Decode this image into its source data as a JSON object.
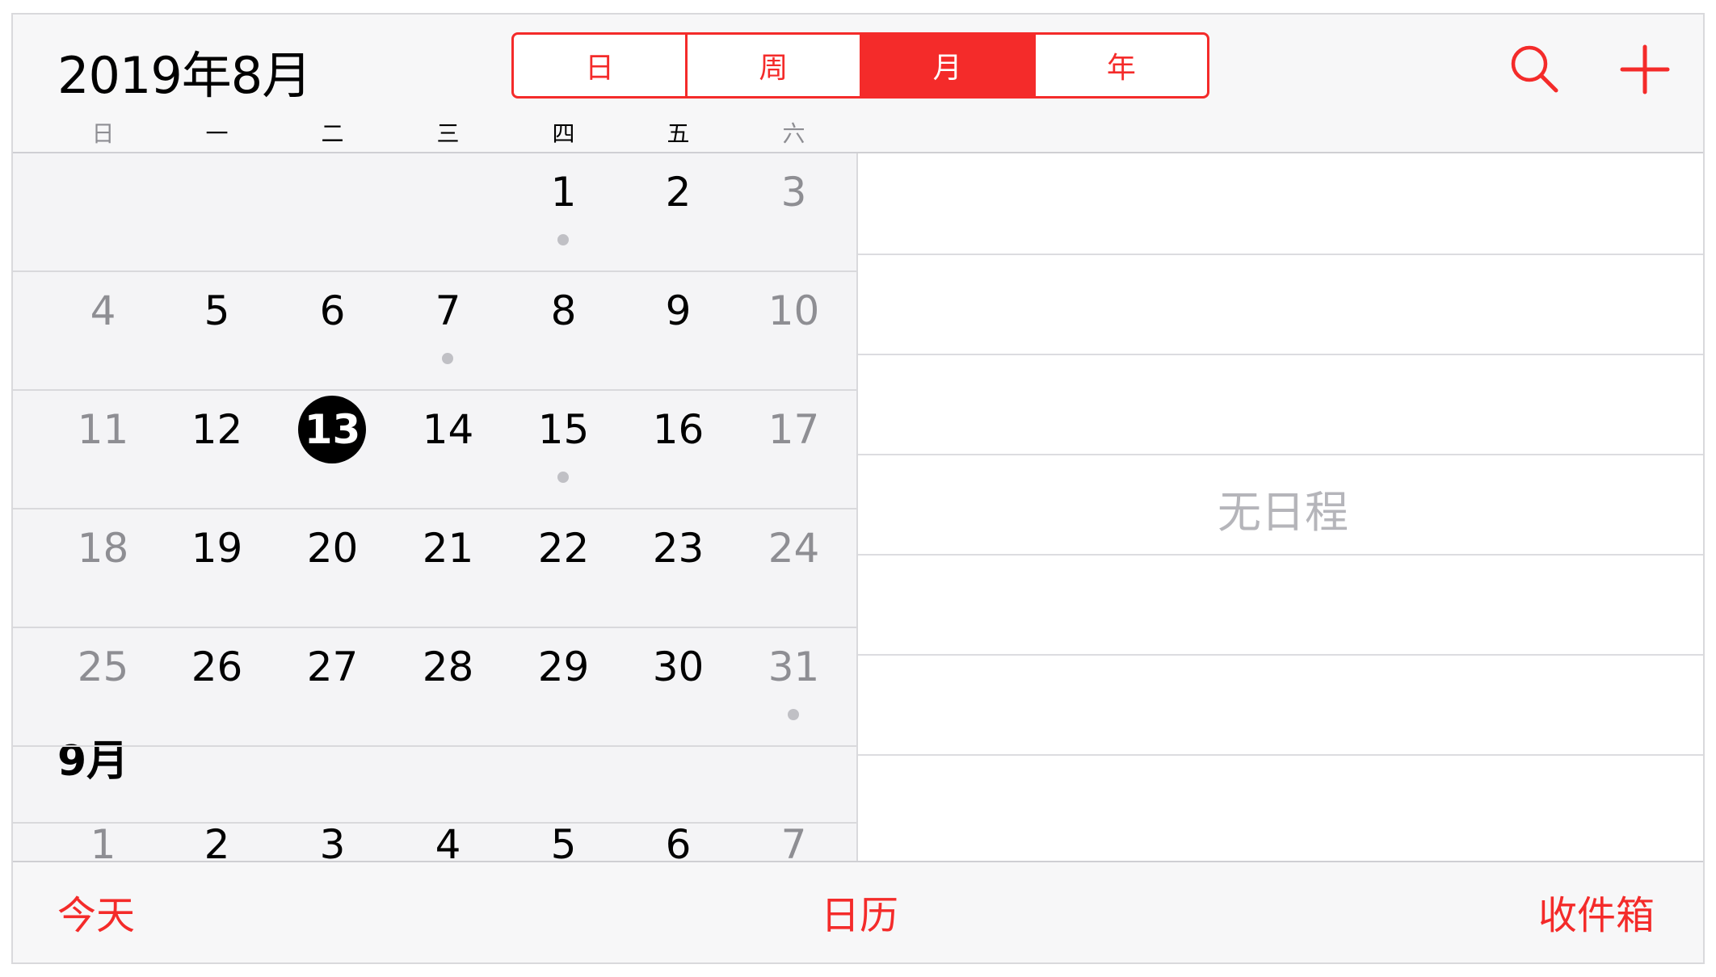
{
  "header": {
    "title": "2019年8月",
    "view_tabs": [
      {
        "label": "日",
        "active": false
      },
      {
        "label": "周",
        "active": false
      },
      {
        "label": "月",
        "active": true
      },
      {
        "label": "年",
        "active": false
      }
    ],
    "search_icon": "search-icon",
    "add_icon": "plus-icon",
    "accent_color": "#f42b2a"
  },
  "weekdays": [
    "日",
    "一",
    "二",
    "三",
    "四",
    "五",
    "六"
  ],
  "calendar": {
    "weeks": [
      [
        {
          "d": ""
        },
        {
          "d": ""
        },
        {
          "d": ""
        },
        {
          "d": ""
        },
        {
          "d": "1",
          "dot": true
        },
        {
          "d": "2"
        },
        {
          "d": "3"
        }
      ],
      [
        {
          "d": "4"
        },
        {
          "d": "5"
        },
        {
          "d": "6"
        },
        {
          "d": "7",
          "dot": true
        },
        {
          "d": "8"
        },
        {
          "d": "9"
        },
        {
          "d": "10"
        }
      ],
      [
        {
          "d": "11"
        },
        {
          "d": "12"
        },
        {
          "d": "13",
          "today": true
        },
        {
          "d": "14"
        },
        {
          "d": "15",
          "dot": true
        },
        {
          "d": "16"
        },
        {
          "d": "17"
        }
      ],
      [
        {
          "d": "18"
        },
        {
          "d": "19"
        },
        {
          "d": "20"
        },
        {
          "d": "21"
        },
        {
          "d": "22"
        },
        {
          "d": "23"
        },
        {
          "d": "24"
        }
      ],
      [
        {
          "d": "25"
        },
        {
          "d": "26"
        },
        {
          "d": "27"
        },
        {
          "d": "28"
        },
        {
          "d": "29"
        },
        {
          "d": "30"
        },
        {
          "d": "31",
          "dot": true
        }
      ]
    ],
    "next_month_label": "9月",
    "next_month_week": [
      {
        "d": "1"
      },
      {
        "d": "2"
      },
      {
        "d": "3"
      },
      {
        "d": "4"
      },
      {
        "d": "5"
      },
      {
        "d": "6"
      },
      {
        "d": "7"
      }
    ]
  },
  "events": {
    "empty_text": "无日程"
  },
  "toolbar": {
    "today_label": "今天",
    "calendars_label": "日历",
    "inbox_label": "收件箱"
  }
}
